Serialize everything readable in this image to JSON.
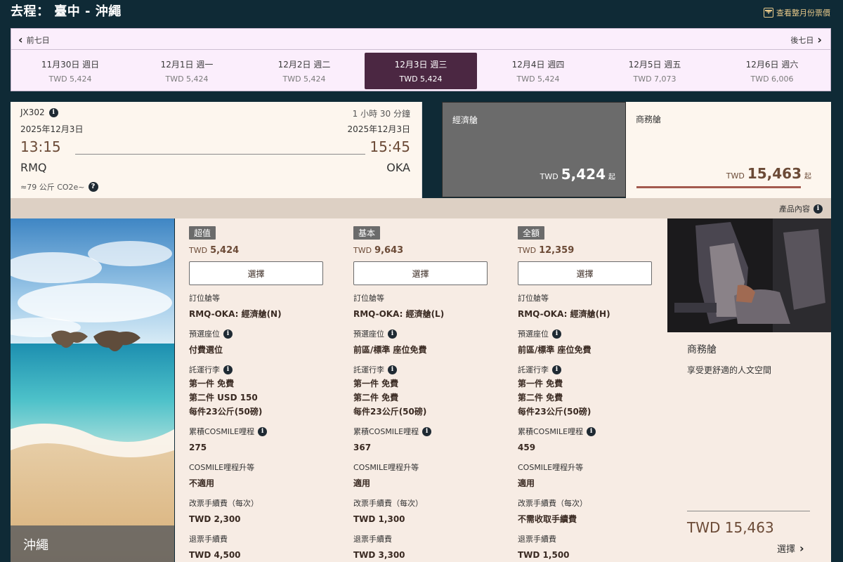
{
  "header": {
    "route_title": "去程： 臺中 - 沖繩",
    "monthly_link": "查看整月份票價"
  },
  "date_nav": {
    "prev_label": "前七日",
    "next_label": "後七日",
    "selected_index": 3,
    "days": [
      {
        "label": "11月30日 週日",
        "price": "TWD 5,424"
      },
      {
        "label": "12月1日 週一",
        "price": "TWD 5,424"
      },
      {
        "label": "12月2日 週二",
        "price": "TWD 5,424"
      },
      {
        "label": "12月3日 週三",
        "price": "TWD 5,424"
      },
      {
        "label": "12月4日 週四",
        "price": "TWD 5,424"
      },
      {
        "label": "12月5日 週五",
        "price": "TWD 7,073"
      },
      {
        "label": "12月6日 週六",
        "price": "TWD 6,006"
      }
    ]
  },
  "flight": {
    "number": "JX302",
    "duration": "1 小時 30 分鐘",
    "departure": {
      "date": "2025年12月3日",
      "time": "13:15",
      "code": "RMQ"
    },
    "arrival": {
      "date": "2025年12月3日",
      "time": "15:45",
      "code": "OKA"
    },
    "co2": "≈79 公斤 CO2e~"
  },
  "cabins": {
    "economy": {
      "name": "經濟艙",
      "currency": "TWD",
      "amount": "5,424",
      "suffix": "起"
    },
    "business": {
      "name": "商務艙",
      "currency": "TWD",
      "amount": "15,463",
      "suffix": "起"
    }
  },
  "product_link": "產品內容",
  "destination": {
    "caption": "沖繩"
  },
  "labels": {
    "booking_class": "訂位艙等",
    "seat_selection": "預選座位",
    "baggage": "託運行李",
    "miles": "累積COSMILE哩程",
    "upgrade": "COSMILE哩程升等",
    "change_fee": "改票手續費（每次）",
    "refund_fee": "退票手續費",
    "select": "選擇"
  },
  "fares": [
    {
      "name": "超值",
      "currency": "TWD",
      "amount": "5,424",
      "booking_class": "RMQ-OKA: 經濟艙(N)",
      "seat": "付費選位",
      "baggage": [
        "第一件 免費",
        "第二件 USD 150",
        "每件23公斤(50磅)"
      ],
      "miles": "275",
      "upgrade": "不適用",
      "change_fee": "TWD 2,300",
      "refund_fee": "TWD 4,500"
    },
    {
      "name": "基本",
      "currency": "TWD",
      "amount": "9,643",
      "booking_class": "RMQ-OKA: 經濟艙(L)",
      "seat": "前區/標準 座位免費",
      "baggage": [
        "第一件 免費",
        "第二件 免費",
        "每件23公斤(50磅)"
      ],
      "miles": "367",
      "upgrade": "適用",
      "change_fee": "TWD 1,300",
      "refund_fee": "TWD 3,300"
    },
    {
      "name": "全額",
      "currency": "TWD",
      "amount": "12,359",
      "booking_class": "RMQ-OKA: 經濟艙(H)",
      "seat": "前區/標準 座位免費",
      "baggage": [
        "第一件 免費",
        "第二件 免費",
        "每件23公斤(50磅)"
      ],
      "miles": "459",
      "upgrade": "適用",
      "change_fee": "不需收取手續費",
      "refund_fee": "TWD 1,500"
    }
  ],
  "business_promo": {
    "title": "商務艙",
    "description": "享受更舒適的人文空間",
    "price": "TWD 15,463",
    "select_label": "選擇"
  },
  "colors": {
    "background": "#0f2a36",
    "accent_selected": "#4b2742",
    "price_brown": "#6b4a36",
    "business_underline": "#a35a4e"
  }
}
